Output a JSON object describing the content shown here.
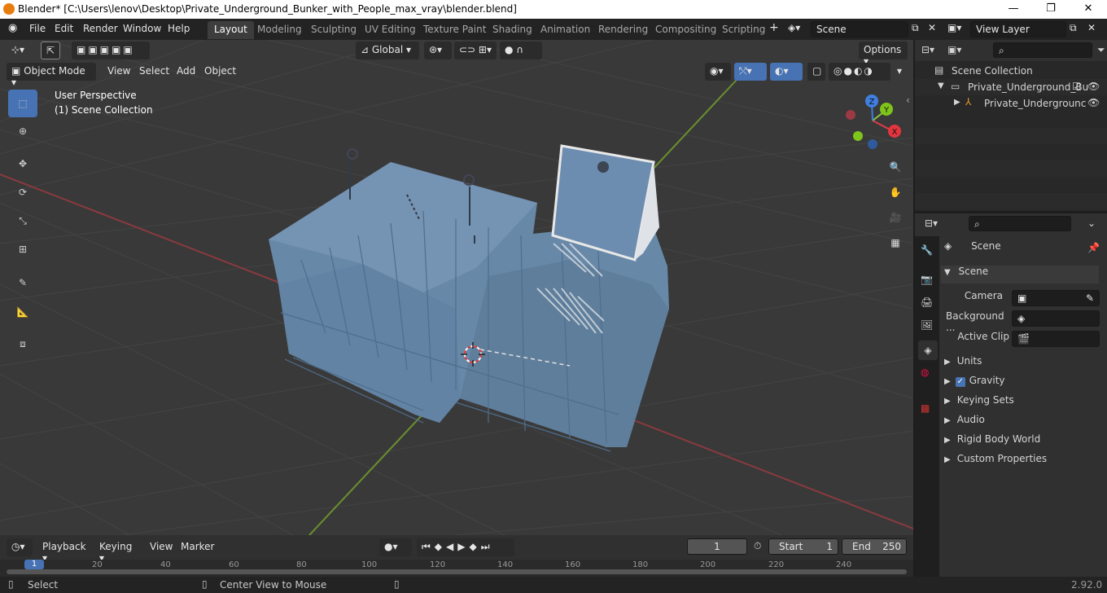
{
  "window": {
    "title": "Blender* [C:\\Users\\lenov\\Desktop\\Private_Underground_Bunker_with_People_max_vray\\blender.blend]"
  },
  "menus": [
    "File",
    "Edit",
    "Render",
    "Window",
    "Help"
  ],
  "workspaces": [
    "Layout",
    "Modeling",
    "Sculpting",
    "UV Editing",
    "Texture Paint",
    "Shading",
    "Animation",
    "Rendering",
    "Compositing",
    "Scripting"
  ],
  "active_workspace": "Layout",
  "scene_field": "Scene",
  "view_layer_field": "View Layer",
  "viewport": {
    "mode": "Object Mode",
    "header_menus": [
      "View",
      "Select",
      "Add",
      "Object"
    ],
    "transform_orientation": "Global",
    "options_label": "Options",
    "info_line1": "User Perspective",
    "info_line2": "(1) Scene Collection",
    "gizmo_axes": {
      "x": "X",
      "y": "Y",
      "z": "Z"
    }
  },
  "outliner": {
    "root": "Scene Collection",
    "collection": "Private_Underground_Bu",
    "object": "Private_Undergrounc"
  },
  "properties": {
    "header": "Scene",
    "panel": "Scene",
    "camera_label": "Camera",
    "background_label": "Background ...",
    "active_clip_label": "Active Clip",
    "subpanels": [
      "Units",
      "Gravity",
      "Keying Sets",
      "Audio",
      "Rigid Body World",
      "Custom Properties"
    ],
    "gravity_checked": true
  },
  "timeline": {
    "menus": [
      "Playback",
      "Keying",
      "View",
      "Marker"
    ],
    "current_frame": "1",
    "start_label": "Start",
    "start_value": "1",
    "end_label": "End",
    "end_value": "250",
    "ruler_marks": [
      "1",
      "20",
      "40",
      "60",
      "80",
      "100",
      "120",
      "140",
      "160",
      "180",
      "200",
      "220",
      "240"
    ]
  },
  "statusbar": {
    "left": "Select",
    "middle": "Center View to Mouse",
    "version": "2.92.0"
  },
  "colors": {
    "accent": "#4772b3",
    "x_axis": "#db3d4a",
    "y_axis": "#8cc63f",
    "z_axis": "#3f7fe0",
    "model": "#6a8aab"
  }
}
